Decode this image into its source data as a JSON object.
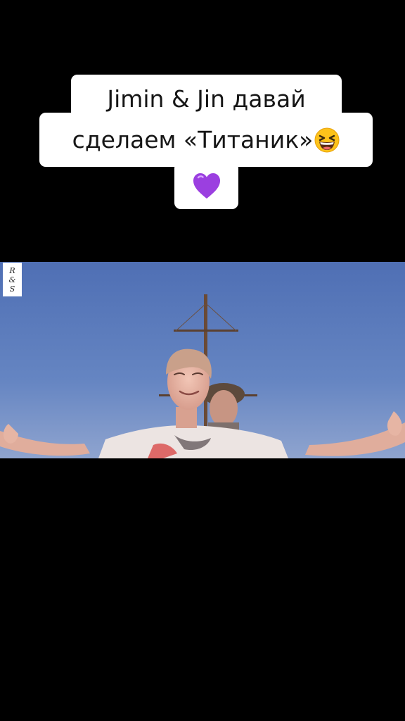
{
  "caption": {
    "line1": "Jimin & Jin давай",
    "line2_text": "сделаем «Титаник»",
    "line2_emoji": "grinning-squinting-face",
    "line3_emoji": "purple-heart"
  },
  "video": {
    "watermark": {
      "line1": "R",
      "line2": "&",
      "line3": "S"
    },
    "scene": "man-with-outstretched-arms-on-ship-bow"
  },
  "colors": {
    "background": "#000000",
    "caption_bg": "#ffffff",
    "caption_text": "#161616",
    "sky": "#5f7fbf",
    "heart": "#9b3fe0"
  }
}
